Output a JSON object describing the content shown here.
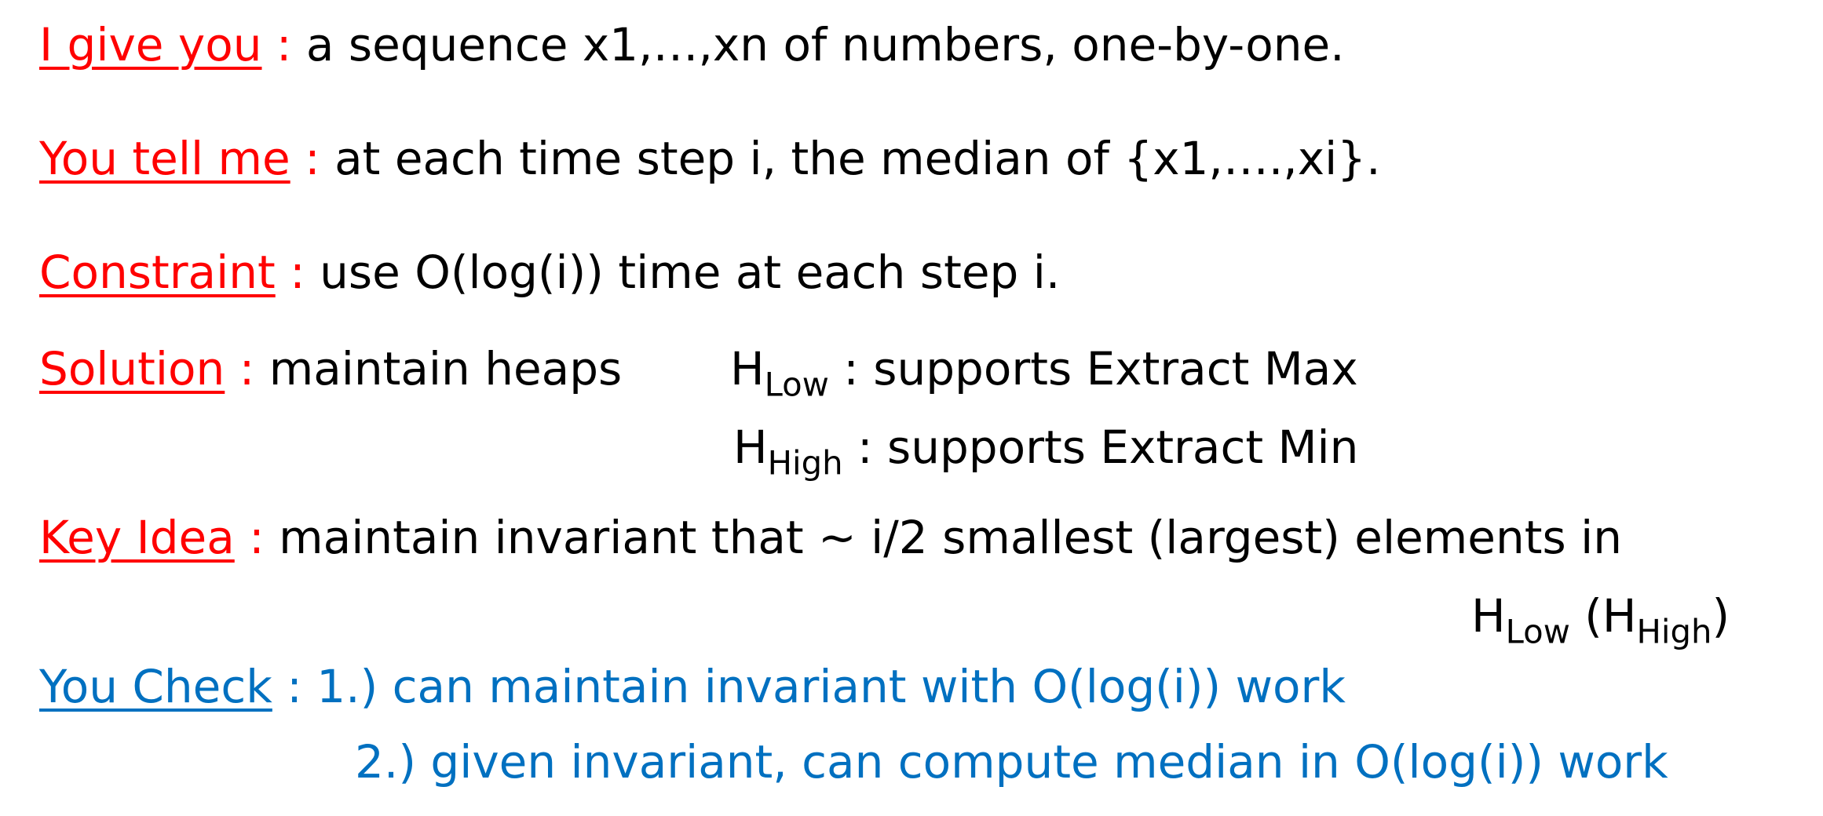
{
  "lines": {
    "give": {
      "label": "I give you",
      "colon": " :",
      "text": " a sequence x1,…,xn of numbers, one-by-one."
    },
    "tell": {
      "label": "You tell me",
      "colon": " :",
      "text": " at each time step i, the median of {x1,….,xi}."
    },
    "constraint": {
      "label": "Constraint",
      "colon": " :",
      "text": " use O(log(i)) time at each step i."
    },
    "solution": {
      "label": "Solution",
      "colon": " :",
      "text": " maintain heaps",
      "heap1_base": "H",
      "heap1_sub": "Low",
      "heap1_desc": " : supports Extract Max",
      "heap2_base": "H",
      "heap2_sub": "High",
      "heap2_desc": " : supports Extract Min"
    },
    "keyidea": {
      "label": "Key Idea",
      "colon": " :",
      "text": " maintain invariant that ~ i/2 smallest (largest) elements in",
      "cont_base1": "H",
      "cont_sub1": "Low",
      "cont_mid": " (H",
      "cont_sub2": "High",
      "cont_end": ")"
    },
    "check": {
      "label": "You Check",
      "text1": " : 1.) can maintain invariant with O(log(i)) work",
      "text2": "2.) given invariant, can compute median in O(log(i)) work"
    }
  },
  "colors": {
    "label_red": "#ff0000",
    "label_blue": "#0070c0",
    "body_text": "#000000"
  }
}
